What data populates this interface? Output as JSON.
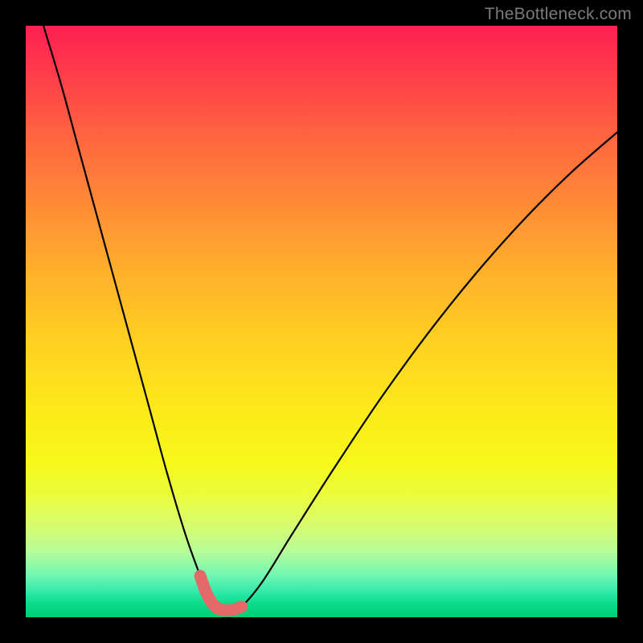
{
  "watermark": "TheBottleneck.com",
  "chart_data": {
    "type": "line",
    "title": "",
    "xlabel": "",
    "ylabel": "",
    "xlim": [
      0,
      100
    ],
    "ylim": [
      0,
      100
    ],
    "series": [
      {
        "name": "bottleneck-curve",
        "x": [
          3,
          6,
          9,
          12,
          15,
          18,
          21,
          24,
          27,
          29.5,
          31,
          33,
          35,
          36.5,
          40,
          45,
          52,
          60,
          68,
          76,
          84,
          92,
          100
        ],
        "y": [
          100,
          90,
          79,
          68,
          57,
          46,
          35,
          24,
          14,
          7,
          3.5,
          1.5,
          1.2,
          1.8,
          6,
          14,
          25,
          37,
          48,
          58,
          67,
          75,
          82
        ]
      },
      {
        "name": "highlight-segment",
        "x": [
          29.5,
          30.5,
          31.5,
          32.5,
          33.5,
          34.5,
          35.5,
          36.5
        ],
        "y": [
          7,
          4.2,
          2.4,
          1.5,
          1.2,
          1.2,
          1.4,
          1.8
        ]
      }
    ],
    "highlight_color": "#e46a6a",
    "curve_color": "#000000"
  }
}
